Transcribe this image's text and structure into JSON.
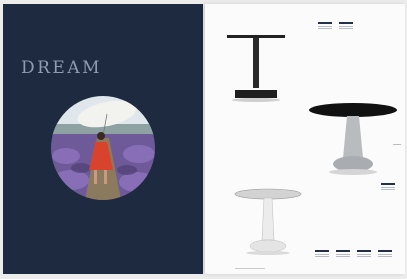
{
  "left_page": {
    "heading": "DREAM",
    "photo": {
      "subject": "woman-in-lavender-field",
      "colors": {
        "sky": "#d9e3ea",
        "lavender": "#7a5fa8",
        "dress": "#d8432d",
        "umbrella": "#f2f2ee"
      }
    }
  },
  "right_page": {
    "products": [
      {
        "name": "table-square-top-pedestal"
      },
      {
        "name": "table-black-round-top-cone-base"
      },
      {
        "name": "table-white-round-top"
      }
    ]
  },
  "colors": {
    "navy": "#1e2a40",
    "paper": "#fbfbfb",
    "accent_bar": "#22304a"
  }
}
